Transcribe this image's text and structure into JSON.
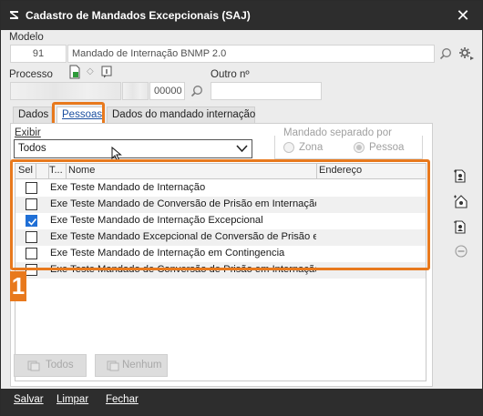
{
  "window": {
    "title": "Cadastro de Mandados Excepcionais (SAJ)"
  },
  "modelo": {
    "label": "Modelo",
    "code": "91",
    "name": "Mandado de Internação BNMP 2.0"
  },
  "processo": {
    "label": "Processo",
    "number_part": "00000",
    "outro_label": "Outro nº",
    "outro_value": ""
  },
  "tabs": [
    {
      "label": "Dados"
    },
    {
      "label": "Pessoas"
    },
    {
      "label": "Dados do mandado internação"
    }
  ],
  "exibir": {
    "label": "Exibir",
    "value": "Todos"
  },
  "mandado_separado": {
    "legend": "Mandado separado por",
    "options": [
      "Zona",
      "Pessoa"
    ],
    "selected": "Pessoa"
  },
  "grid": {
    "columns": [
      "Sel",
      "T...",
      "Nome",
      "Endereço"
    ],
    "rows": [
      {
        "checked": false,
        "nome": "Exe Teste Mandado de Internação",
        "endereco": ""
      },
      {
        "checked": false,
        "nome": "Exe Teste Mandado de Conversão de Prisão em Internação",
        "endereco": ""
      },
      {
        "checked": true,
        "nome": "Exe Teste Mandado de Internação Excepcional",
        "endereco": ""
      },
      {
        "checked": false,
        "nome": "Exe Teste Mandado Excepcional de Conversão de Prisão em Internação",
        "endereco": ""
      },
      {
        "checked": false,
        "nome": "Exe Teste Mandado de Internação em Contingencia",
        "endereco": ""
      },
      {
        "checked": false,
        "nome": "Exe Teste Mandado de Conversão de Prisão em Internação",
        "endereco": ""
      }
    ]
  },
  "annotation": {
    "badge": "1",
    "color": "#e8791d"
  },
  "buttons": {
    "todos": "Todos",
    "nenhum": "Nenhum"
  },
  "footer": {
    "salvar": "Salvar",
    "limpar": "Limpar",
    "fechar": "Fechar"
  },
  "colors": {
    "titlebar": "#2d2d2d",
    "highlight": "#e8791d",
    "check": "#1f6fd6"
  },
  "icons": [
    "search-icon",
    "settings-icon",
    "document-icon",
    "info-icon",
    "add-person-icon",
    "remove-icon"
  ]
}
